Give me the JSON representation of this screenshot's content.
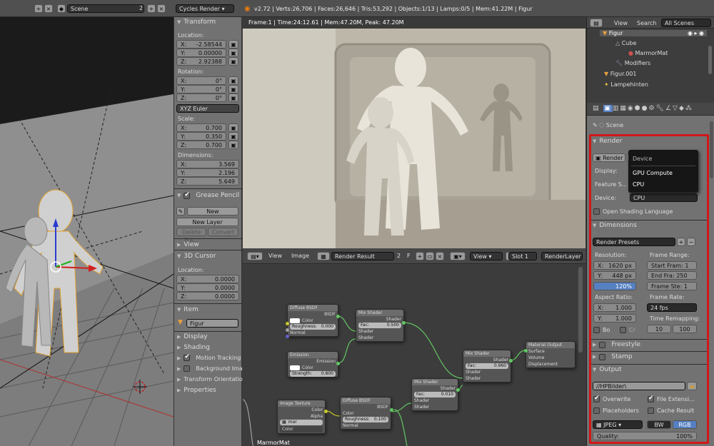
{
  "topbar": {
    "scene": "Scene",
    "scene_num": "2",
    "engine": "Cycles Render",
    "stats": "v2.72 | Verts:26,706 | Faces:26,646 | Tris:53,292 | Objects:1/13 | Lamps:0/5 | Mem:41.22M | Figur"
  },
  "npanel": {
    "transform_title": "Transform",
    "location_label": "Location:",
    "loc": [
      "X:",
      "-2.58544",
      "Y:",
      "0.00000",
      "Z:",
      "2.92388"
    ],
    "rotation_label": "Rotation:",
    "rot": [
      "X:",
      "0°",
      "Y:",
      "0°",
      "Z:",
      "0°"
    ],
    "rot_mode": "XYZ Euler",
    "scale_label": "Scale:",
    "scale": [
      "X:",
      "0.700",
      "Y:",
      "0.350",
      "Z:",
      "0.700"
    ],
    "dim_label": "Dimensions:",
    "dim": [
      "X:",
      "3.569",
      "Y:",
      "2.196",
      "Z:",
      "5.649"
    ],
    "grease_title": "Grease Pencil",
    "gp_new": "New",
    "gp_new_layer": "New Layer",
    "gp_delete": "Delete Fra...",
    "gp_convert": "Convert",
    "view_title": "View",
    "cursor_title": "3D Cursor",
    "cursor_loc_label": "Location:",
    "cursor": [
      "X:",
      "0.0000",
      "Y:",
      "0.0000",
      "Z:",
      "0.0000"
    ],
    "item_title": "Item",
    "item_name": "Figur",
    "display": "Display",
    "shading": "Shading",
    "motion": "Motion Tracking",
    "background": "Background Images",
    "orient": "Transform Orientations",
    "properties": "Properties"
  },
  "render": {
    "info": "Frame:1 | Time:24:12.61 | Mem:47.20M, Peak: 47.20M"
  },
  "imgheader": {
    "view": "View",
    "image": "Image",
    "result": "Render Result",
    "num": "2",
    "f": "F",
    "view2": "View",
    "slot": "Slot 1",
    "layer": "RenderLayer"
  },
  "nodes": {
    "diffuse1": {
      "title": "Diffuse BSDF",
      "out": "BSDF",
      "color": "Color",
      "rough": "Roughness:",
      "rough_v": "0.000",
      "normal": "Normal"
    },
    "emission": {
      "title": "Emission",
      "out": "Emission",
      "color": "Color",
      "strength": "Strength:",
      "strength_v": "0.800"
    },
    "mix1": {
      "title": "Mix Shader",
      "out": "Shader",
      "fac": "Fac:",
      "fac_v": "0.500",
      "s1": "Shader",
      "s2": "Shader"
    },
    "mix2": {
      "title": "Mix Shader",
      "out": "Shader",
      "fac": "Fac:",
      "fac_v": "0.960",
      "s1": "Shader",
      "s2": "Shader"
    },
    "output": {
      "title": "Material Output",
      "surface": "Surface",
      "volume": "Volume",
      "disp": "Displacement"
    },
    "mix3": {
      "title": "Mix Shader",
      "out": "Shader",
      "fac": "Fac:",
      "fac_v": "0.010",
      "s1": "Shader",
      "s2": "Shader"
    },
    "imgtex": {
      "title": "Image Texture",
      "color": "Color",
      "alpha": "Alpha",
      "mar": "mar",
      "color_sel": "Color"
    },
    "diffuse2": {
      "title": "Diffuse BSDF",
      "out": "BSDF",
      "color": "Color",
      "rough": "Roughness:",
      "rough_v": "0.100",
      "normal": "Normal"
    },
    "footer": "MarmorMat"
  },
  "outliner": {
    "view": "View",
    "search": "Search",
    "all": "All Scenes",
    "items": [
      "Figur",
      "Cube",
      "MarmorMat",
      "Modifiers",
      "Figur.001",
      "Lampehinten"
    ]
  },
  "props": {
    "scene": "Scene",
    "render_title": "Render",
    "render_btn": "Render",
    "display_label": "Display:",
    "feature_label": "Feature S...",
    "device_label": "Device:",
    "device_value": "CPU",
    "dropdown": {
      "title": "Device",
      "opt1": "GPU Compute",
      "opt2": "CPU"
    },
    "osl": "Open Shading Language",
    "dim_title": "Dimensions",
    "presets": "Render Presets",
    "resolution": "Resolution:",
    "res_x": "X:",
    "res_x_v": "1620 px",
    "res_y": "Y:",
    "res_y_v": "448 px",
    "res_pct": "120%",
    "frame_range": "Frame Range:",
    "start": "Start Fram: 1",
    "end": "End Fra: 250",
    "step": "Frame Ste: 1",
    "aspect": "Aspect Ratio:",
    "asp_x": "X:",
    "asp_x_v": "1.000",
    "asp_y": "Y:",
    "asp_y_v": "1.000",
    "frame_rate": "Frame Rate:",
    "fps": "24 fps",
    "time_remap": "Time Remapping:",
    "tr_old": "10",
    "tr_new": "100",
    "bo": "Bo",
    "cr": "Cr",
    "freestyle": "Freestyle",
    "stamp": "Stamp",
    "output_title": "Output",
    "path": "//HPBilder\\",
    "overwrite": "Overwrite",
    "file_ext": "File Extensi...",
    "placeholders": "Placeholders",
    "cache": "Cache Result",
    "format": "JPEG",
    "bw": "BW",
    "rgb": "RGB",
    "quality": "Quality:",
    "quality_v": "100%"
  },
  "colors": {
    "highlight": "#d01818",
    "accent": "#5680c2"
  }
}
